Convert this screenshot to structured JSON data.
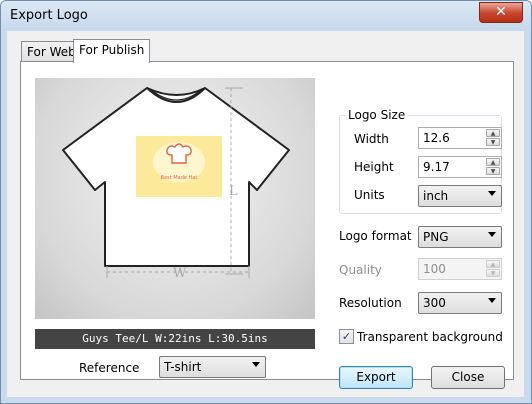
{
  "window": {
    "title": "Export Logo",
    "close_glyph": "✕"
  },
  "tabs": [
    {
      "label": "For Web",
      "active": false
    },
    {
      "label": "For Publish",
      "active": true
    }
  ],
  "preview": {
    "caption": "Guys Tee/L  W:22ins  L:30.5ins",
    "dim_width_letter": "W",
    "dim_length_letter": "L",
    "logo_text": "Best Made Hat"
  },
  "reference": {
    "label": "Reference",
    "value": "T-shirt"
  },
  "logo_size": {
    "title": "Logo Size",
    "width_label": "Width",
    "width_value": "12.6",
    "height_label": "Height",
    "height_value": "9.17",
    "units_label": "Units",
    "units_value": "inch"
  },
  "format": {
    "label": "Logo format",
    "value": "PNG"
  },
  "quality": {
    "label": "Quality",
    "value": "100"
  },
  "resolution": {
    "label": "Resolution",
    "value": "300"
  },
  "transparent": {
    "label": "Transparent background",
    "checked": true,
    "check_glyph": "✓"
  },
  "buttons": {
    "export": "Export",
    "close": "Close"
  },
  "spin_glyphs": {
    "up": "▲",
    "down": "▼"
  },
  "colors": {
    "titlebar": "#c9daeb",
    "logo_bg": "#fde99a",
    "logo_accent": "#e0643a",
    "caption_bg": "#444444"
  }
}
